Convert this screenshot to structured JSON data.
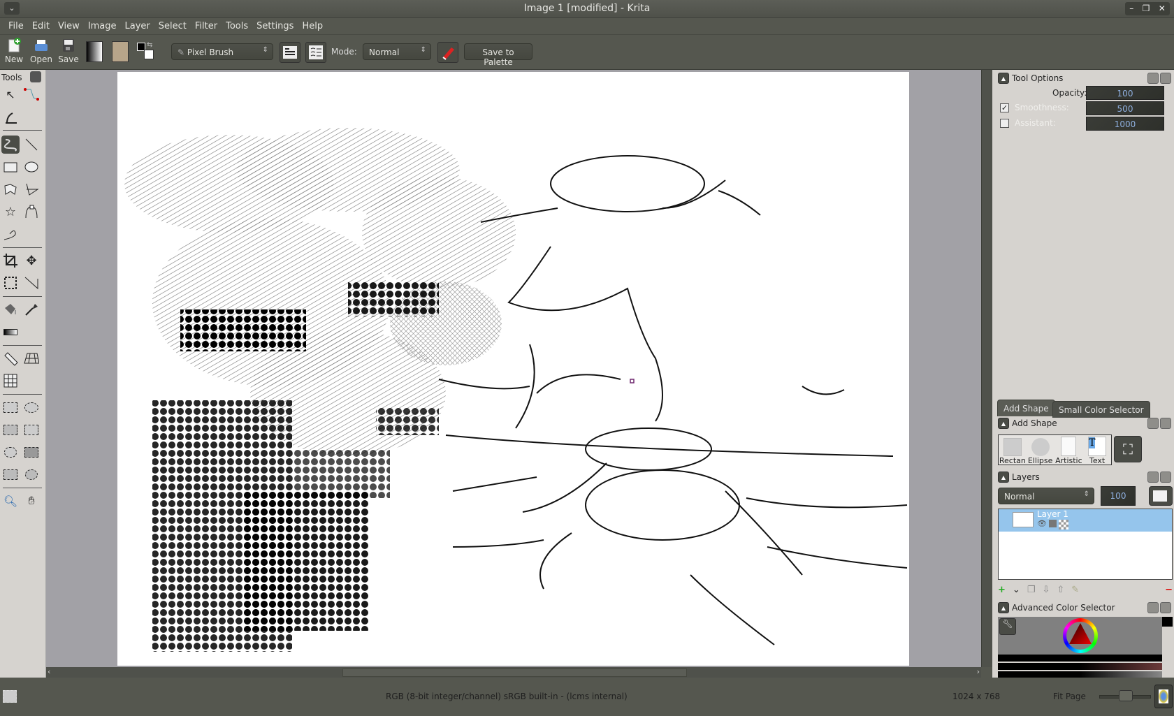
{
  "window": {
    "title": "Image 1 [modified] - Krita",
    "controls": [
      "minimize-icon",
      "restore-icon",
      "close-icon"
    ]
  },
  "menu": [
    "File",
    "Edit",
    "View",
    "Image",
    "Layer",
    "Select",
    "Filter",
    "Tools",
    "Settings",
    "Help"
  ],
  "toolbar": {
    "new_label": "New",
    "open_label": "Open",
    "save_label": "Save",
    "brush_preset": "Pixel Brush",
    "mode_label": "Mode:",
    "mode_value": "Normal",
    "save_palette_label": "Save to Palette"
  },
  "toolbox": {
    "title": "Tools"
  },
  "tool_options": {
    "title": "Tool Options",
    "opacity_label": "Opacity:",
    "opacity_value": "100",
    "smoothness_label": "Smoothness:",
    "smoothness_value": "500",
    "smoothness_checked": true,
    "assistant_label": "Assistant:",
    "assistant_value": "1000",
    "assistant_checked": false
  },
  "docker_tabs": [
    "Add Shape",
    "Small Color Selector"
  ],
  "add_shape": {
    "title": "Add Shape",
    "shapes": [
      "Rectan",
      "Ellipse",
      "Artistic",
      "Text"
    ]
  },
  "layers": {
    "title": "Layers",
    "blend_mode": "Normal",
    "opacity": "100",
    "items": [
      {
        "name": "Layer 1",
        "selected": true
      }
    ]
  },
  "color_selector": {
    "title": "Advanced Color Selector",
    "current_color": "#000000"
  },
  "statusbar": {
    "color_info": "RGB (8-bit integer/channel)  sRGB built-in - (lcms internal)",
    "dimensions": "1024 x 768",
    "zoom_label": "Fit Page"
  },
  "colors": {
    "accent": "#95c5ec",
    "chrome": "#55574f",
    "panel": "#d6d3cf",
    "spin_text": "#8fb0e0"
  }
}
